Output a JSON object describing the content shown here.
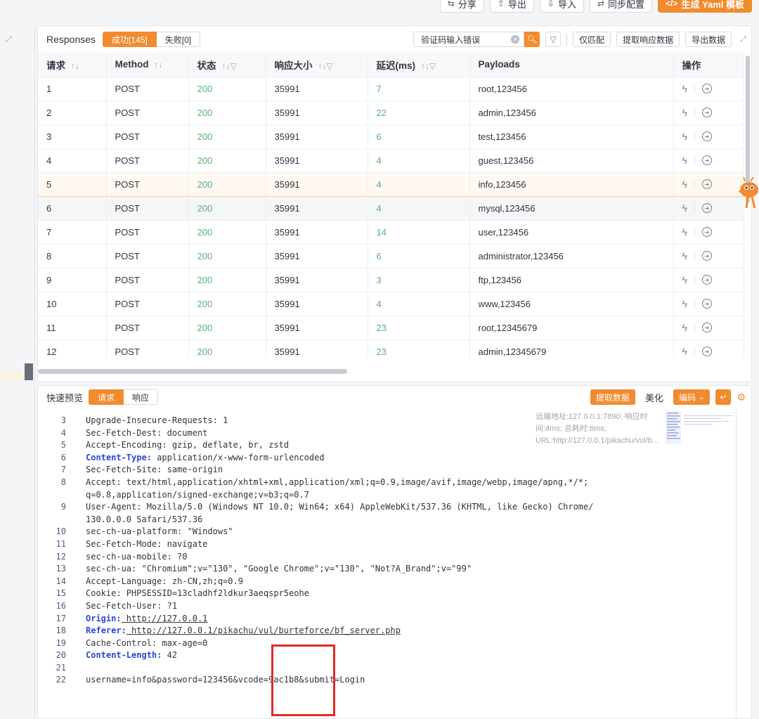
{
  "toolbar": {
    "share": "分享",
    "export": "导出",
    "import": "导入",
    "sync": "同步配置",
    "yaml": "生成 Yaml 模板"
  },
  "responses": {
    "title": "Responses",
    "tab_success": "成功[145]",
    "tab_fail": "失败[0]",
    "search_value": "验证码输入错误",
    "match_only": "仅匹配",
    "extract_data": "提取响应数据",
    "export_data": "导出数据",
    "columns": [
      "请求",
      "Method",
      "状态",
      "响应大小",
      "延迟(ms)",
      "Payloads",
      "操作"
    ],
    "rows": [
      {
        "req": "1",
        "method": "POST",
        "status": "200",
        "size": "35991",
        "delay": "7",
        "payload": "root,123456"
      },
      {
        "req": "2",
        "method": "POST",
        "status": "200",
        "size": "35991",
        "delay": "22",
        "payload": "admin,123456"
      },
      {
        "req": "3",
        "method": "POST",
        "status": "200",
        "size": "35991",
        "delay": "6",
        "payload": "test,123456"
      },
      {
        "req": "4",
        "method": "POST",
        "status": "200",
        "size": "35991",
        "delay": "4",
        "payload": "guest,123456"
      },
      {
        "req": "5",
        "method": "POST",
        "status": "200",
        "size": "35991",
        "delay": "4",
        "payload": "info,123456"
      },
      {
        "req": "6",
        "method": "POST",
        "status": "200",
        "size": "35991",
        "delay": "4",
        "payload": "mysql,123456"
      },
      {
        "req": "7",
        "method": "POST",
        "status": "200",
        "size": "35991",
        "delay": "14",
        "payload": "user,123456"
      },
      {
        "req": "8",
        "method": "POST",
        "status": "200",
        "size": "35991",
        "delay": "6",
        "payload": "administrator,123456"
      },
      {
        "req": "9",
        "method": "POST",
        "status": "200",
        "size": "35991",
        "delay": "3",
        "payload": "ftp,123456"
      },
      {
        "req": "10",
        "method": "POST",
        "status": "200",
        "size": "35991",
        "delay": "4",
        "payload": "www,123456"
      },
      {
        "req": "11",
        "method": "POST",
        "status": "200",
        "size": "35991",
        "delay": "23",
        "payload": "root,12345679"
      },
      {
        "req": "12",
        "method": "POST",
        "status": "200",
        "size": "35991",
        "delay": "23",
        "payload": "admin,12345679"
      }
    ]
  },
  "preview": {
    "title": "快速预览",
    "tab_request": "请求",
    "tab_response": "响应",
    "extract": "提取数据",
    "beautify": "美化",
    "encode": "编码",
    "info": "远端地址:127.0.0.1:7890; 响应时间:4ms; 总耗时:6ms; URL:http://127.0.0.1/pikachu/vul/b...",
    "lines": [
      {
        "n": "3",
        "k": "Upgrade-Insecure-Requests:",
        "v": " 1"
      },
      {
        "n": "4",
        "k": "Sec-Fetch-Dest:",
        "v": " document"
      },
      {
        "n": "5",
        "k": "Accept-Encoding:",
        "v": " gzip, deflate, br, zstd"
      },
      {
        "n": "6",
        "k": "Content-Type:",
        "v": " application/x-www-form-urlencoded",
        "bold": true
      },
      {
        "n": "7",
        "k": "Sec-Fetch-Site:",
        "v": " same-origin"
      },
      {
        "n": "8",
        "k": "Accept:",
        "v": " text/html,application/xhtml+xml,application/xml;q=0.9,image/avif,image/webp,image/apng,*/*;"
      },
      {
        "n": "",
        "k": "",
        "v": "q=0.8,application/signed-exchange;v=b3;q=0.7"
      },
      {
        "n": "9",
        "k": "User-Agent:",
        "v": " Mozilla/5.0 (Windows NT 10.0; Win64; x64) AppleWebKit/537.36 (KHTML, like Gecko) Chrome/"
      },
      {
        "n": "",
        "k": "",
        "v": "130.0.0.0 Safari/537.36"
      },
      {
        "n": "10",
        "k": "sec-ch-ua-platform:",
        "v": " \"Windows\""
      },
      {
        "n": "11",
        "k": "Sec-Fetch-Mode:",
        "v": " navigate"
      },
      {
        "n": "12",
        "k": "sec-ch-ua-mobile:",
        "v": " ?0"
      },
      {
        "n": "13",
        "k": "sec-ch-ua:",
        "v": " \"Chromium\";v=\"130\", \"Google Chrome\";v=\"130\", \"Not?A_Brand\";v=\"99\""
      },
      {
        "n": "14",
        "k": "Accept-Language:",
        "v": " zh-CN,zh;q=0.9"
      },
      {
        "n": "15",
        "k": "Cookie:",
        "v": " PHPSESSID=13cladhf2ldkur3aeqspr5eohe"
      },
      {
        "n": "16",
        "k": "Sec-Fetch-User:",
        "v": " ?1"
      },
      {
        "n": "17",
        "k": "Origin:",
        "v": " http://127.0.0.1",
        "bold": true,
        "url": true
      },
      {
        "n": "18",
        "k": "Referer:",
        "v": " http://127.0.0.1/pikachu/vul/burteforce/bf_server.php",
        "bold": true,
        "url": true
      },
      {
        "n": "19",
        "k": "Cache-Control:",
        "v": " max-age=0"
      },
      {
        "n": "20",
        "k": "Content-Length:",
        "v": " 42",
        "bold": true
      },
      {
        "n": "21",
        "k": "",
        "v": ""
      },
      {
        "n": "22",
        "k": "",
        "v": "username=info&password=123456&vcode=9ac1b8&submit=Login"
      }
    ]
  },
  "colors": {
    "accent": "#f28b2e",
    "status_green": "#56b36e",
    "header_key": "#2a46d6",
    "highlight_box": "#e02a2a"
  }
}
